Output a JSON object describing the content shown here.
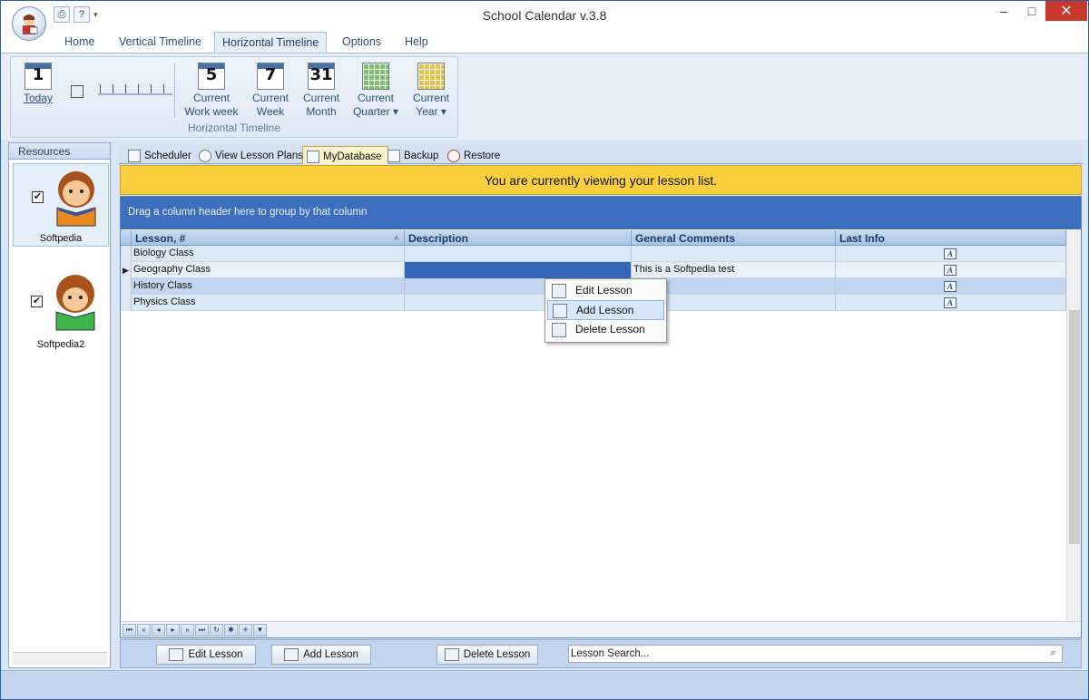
{
  "window": {
    "title": "School Calendar v.3.8",
    "min": "–",
    "max": "□",
    "close": "✕"
  },
  "qat": {
    "print": "⎙",
    "help": "?",
    "more": "▾"
  },
  "ribbon": {
    "tabs": [
      "Home",
      "Vertical Timeline",
      "Horizontal Timeline",
      "Options",
      "Help"
    ],
    "active_tab": "Horizontal Timeline",
    "group_label": "Horizontal Timeline",
    "today": {
      "num": "1",
      "label": "Today"
    },
    "buttons": [
      {
        "num": "5",
        "line1": "Current",
        "line2": "Work week"
      },
      {
        "num": "7",
        "line1": "Current",
        "line2": "Week"
      },
      {
        "num": "31",
        "line1": "Current",
        "line2": "Month"
      },
      {
        "line1": "Current",
        "line2": "Quarter ▾"
      },
      {
        "line1": "Current",
        "line2": "Year ▾"
      }
    ]
  },
  "resources": {
    "header": "Resources",
    "items": [
      {
        "name": "Softpedia",
        "checked": "✔",
        "color": "#e98a1e"
      },
      {
        "name": "Softpedia2",
        "checked": "✔",
        "color": "#3fb54a"
      }
    ]
  },
  "doc_tabs": [
    "Scheduler",
    "View Lesson Plans",
    "MyDatabase",
    "Backup",
    "Restore"
  ],
  "banner": "You are currently viewing your lesson list.",
  "grid": {
    "group_hint": "Drag a column header here to group by that column",
    "columns": [
      "Lesson, #",
      "Description",
      "General Comments",
      "Last Info"
    ],
    "sort_indicator": "▴",
    "rows": [
      {
        "lesson": "Biology Class",
        "description": "",
        "comments": "",
        "info": "A"
      },
      {
        "lesson": "Geography Class",
        "description": "",
        "comments": "This is a Softpedia test",
        "info": "A"
      },
      {
        "lesson": "History Class",
        "description": "",
        "comments": "",
        "info": "A"
      },
      {
        "lesson": "Physics Class",
        "description": "",
        "comments": "",
        "info": "A"
      }
    ],
    "current_row_marker": "▶"
  },
  "context_menu": {
    "items": [
      "Edit Lesson",
      "Add Lesson",
      "Delete Lesson"
    ],
    "hovered": "Add Lesson"
  },
  "bottom": {
    "edit": "Edit Lesson",
    "add": "Add Lesson",
    "delete": "Delete Lesson",
    "search_text": "Lesson Search...",
    "search_icon": "binoculars-icon"
  },
  "colors": {
    "accent": "#3d6fbe",
    "banner": "#fccf3e",
    "close": "#c7392c"
  }
}
